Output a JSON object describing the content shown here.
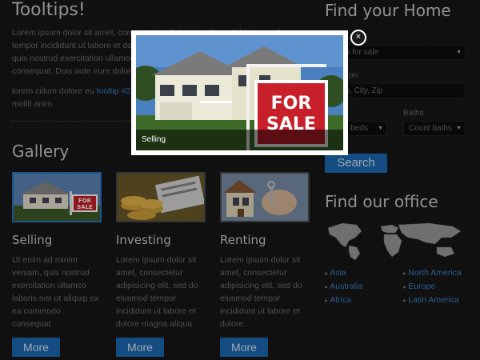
{
  "tooltips": {
    "title": "Tooltips!",
    "paragraph1": "Lorem ipsum dolor sit amet, consectetur adipisicing elit, sed do eiusmod tempor incididunt ut labore et dolore magna aliqua. Ut enim ad minim veniam, quis nostrud exercitation ullamco laboris nisi ut aliquip ex ea commodo consequat. Duis aute irure dolor in reprehenderit in voluptate",
    "paragraph2_before": "lorem cillum dolore eu ",
    "paragraph2_link": "tooltip #2",
    "paragraph2_after": " proident, sunt in culpa qui officia deserunt mollit anim"
  },
  "gallery": {
    "title": "Gallery",
    "cards": [
      {
        "title": "Selling",
        "text": "Ut enim ad minim veniam, quis nostrud exercitation ullamco laboris nisi ut aliquip ex ea commodo consequat.",
        "button": "More"
      },
      {
        "title": "Investing",
        "text": "Lorem ipsum dolor sit amet, consectetur adipisicing elit, sed do eiusmod tempor incididunt ut labore et dolore magna aliqua.",
        "button": "More"
      },
      {
        "title": "Renting",
        "text": "Lorem ipsum dolor sit amet, consectetur adipisicing elit, sed do eiusmod tempor incididunt ut labore et dolore.",
        "button": "More"
      }
    ]
  },
  "find_home": {
    "title": "Find your Home",
    "type_select": "es for sale",
    "location_label": "on",
    "location_placeholder": "ss, City, Zip",
    "baths_label": "Baths",
    "beds_select": "nt beds",
    "baths_select": "Count baths",
    "search_button": "Search"
  },
  "find_office": {
    "title": "Find our office",
    "locations_left": [
      "Asia",
      "Australia",
      "Africa"
    ],
    "locations_right": [
      "North America",
      "Europe",
      "Latin America"
    ]
  },
  "lightbox": {
    "caption": "Selling",
    "sign_line1": "FOR",
    "sign_line2": "SALE",
    "close": "×"
  },
  "colors": {
    "accent": "#1e6bb5",
    "link": "#3b80c7",
    "background": "#161616",
    "sign_red": "#c8202a"
  }
}
